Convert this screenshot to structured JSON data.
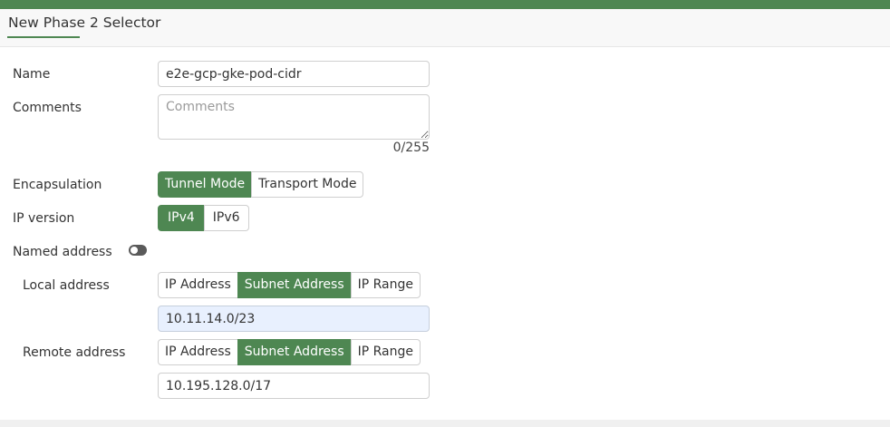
{
  "header": {
    "title": "New Phase 2 Selector"
  },
  "form": {
    "name": {
      "label": "Name",
      "value": "e2e-gcp-gke-pod-cidr"
    },
    "comments": {
      "label": "Comments",
      "placeholder": "Comments",
      "value": "",
      "counter": "0/255"
    },
    "encapsulation": {
      "label": "Encapsulation",
      "options": [
        "Tunnel Mode",
        "Transport Mode"
      ],
      "selected": "Tunnel Mode"
    },
    "ip_version": {
      "label": "IP version",
      "options": [
        "IPv4",
        "IPv6"
      ],
      "selected": "IPv4"
    },
    "named_address": {
      "label": "Named address",
      "enabled": false
    },
    "local_address": {
      "label": "Local address",
      "options": [
        "IP Address",
        "Subnet Address",
        "IP Range"
      ],
      "selected": "Subnet Address",
      "value": "10.11.14.0/23"
    },
    "remote_address": {
      "label": "Remote address",
      "options": [
        "IP Address",
        "Subnet Address",
        "IP Range"
      ],
      "selected": "Subnet Address",
      "value": "10.195.128.0/17"
    }
  },
  "colors": {
    "accent": "#4e8752",
    "autofill": "#e8f0fe"
  }
}
